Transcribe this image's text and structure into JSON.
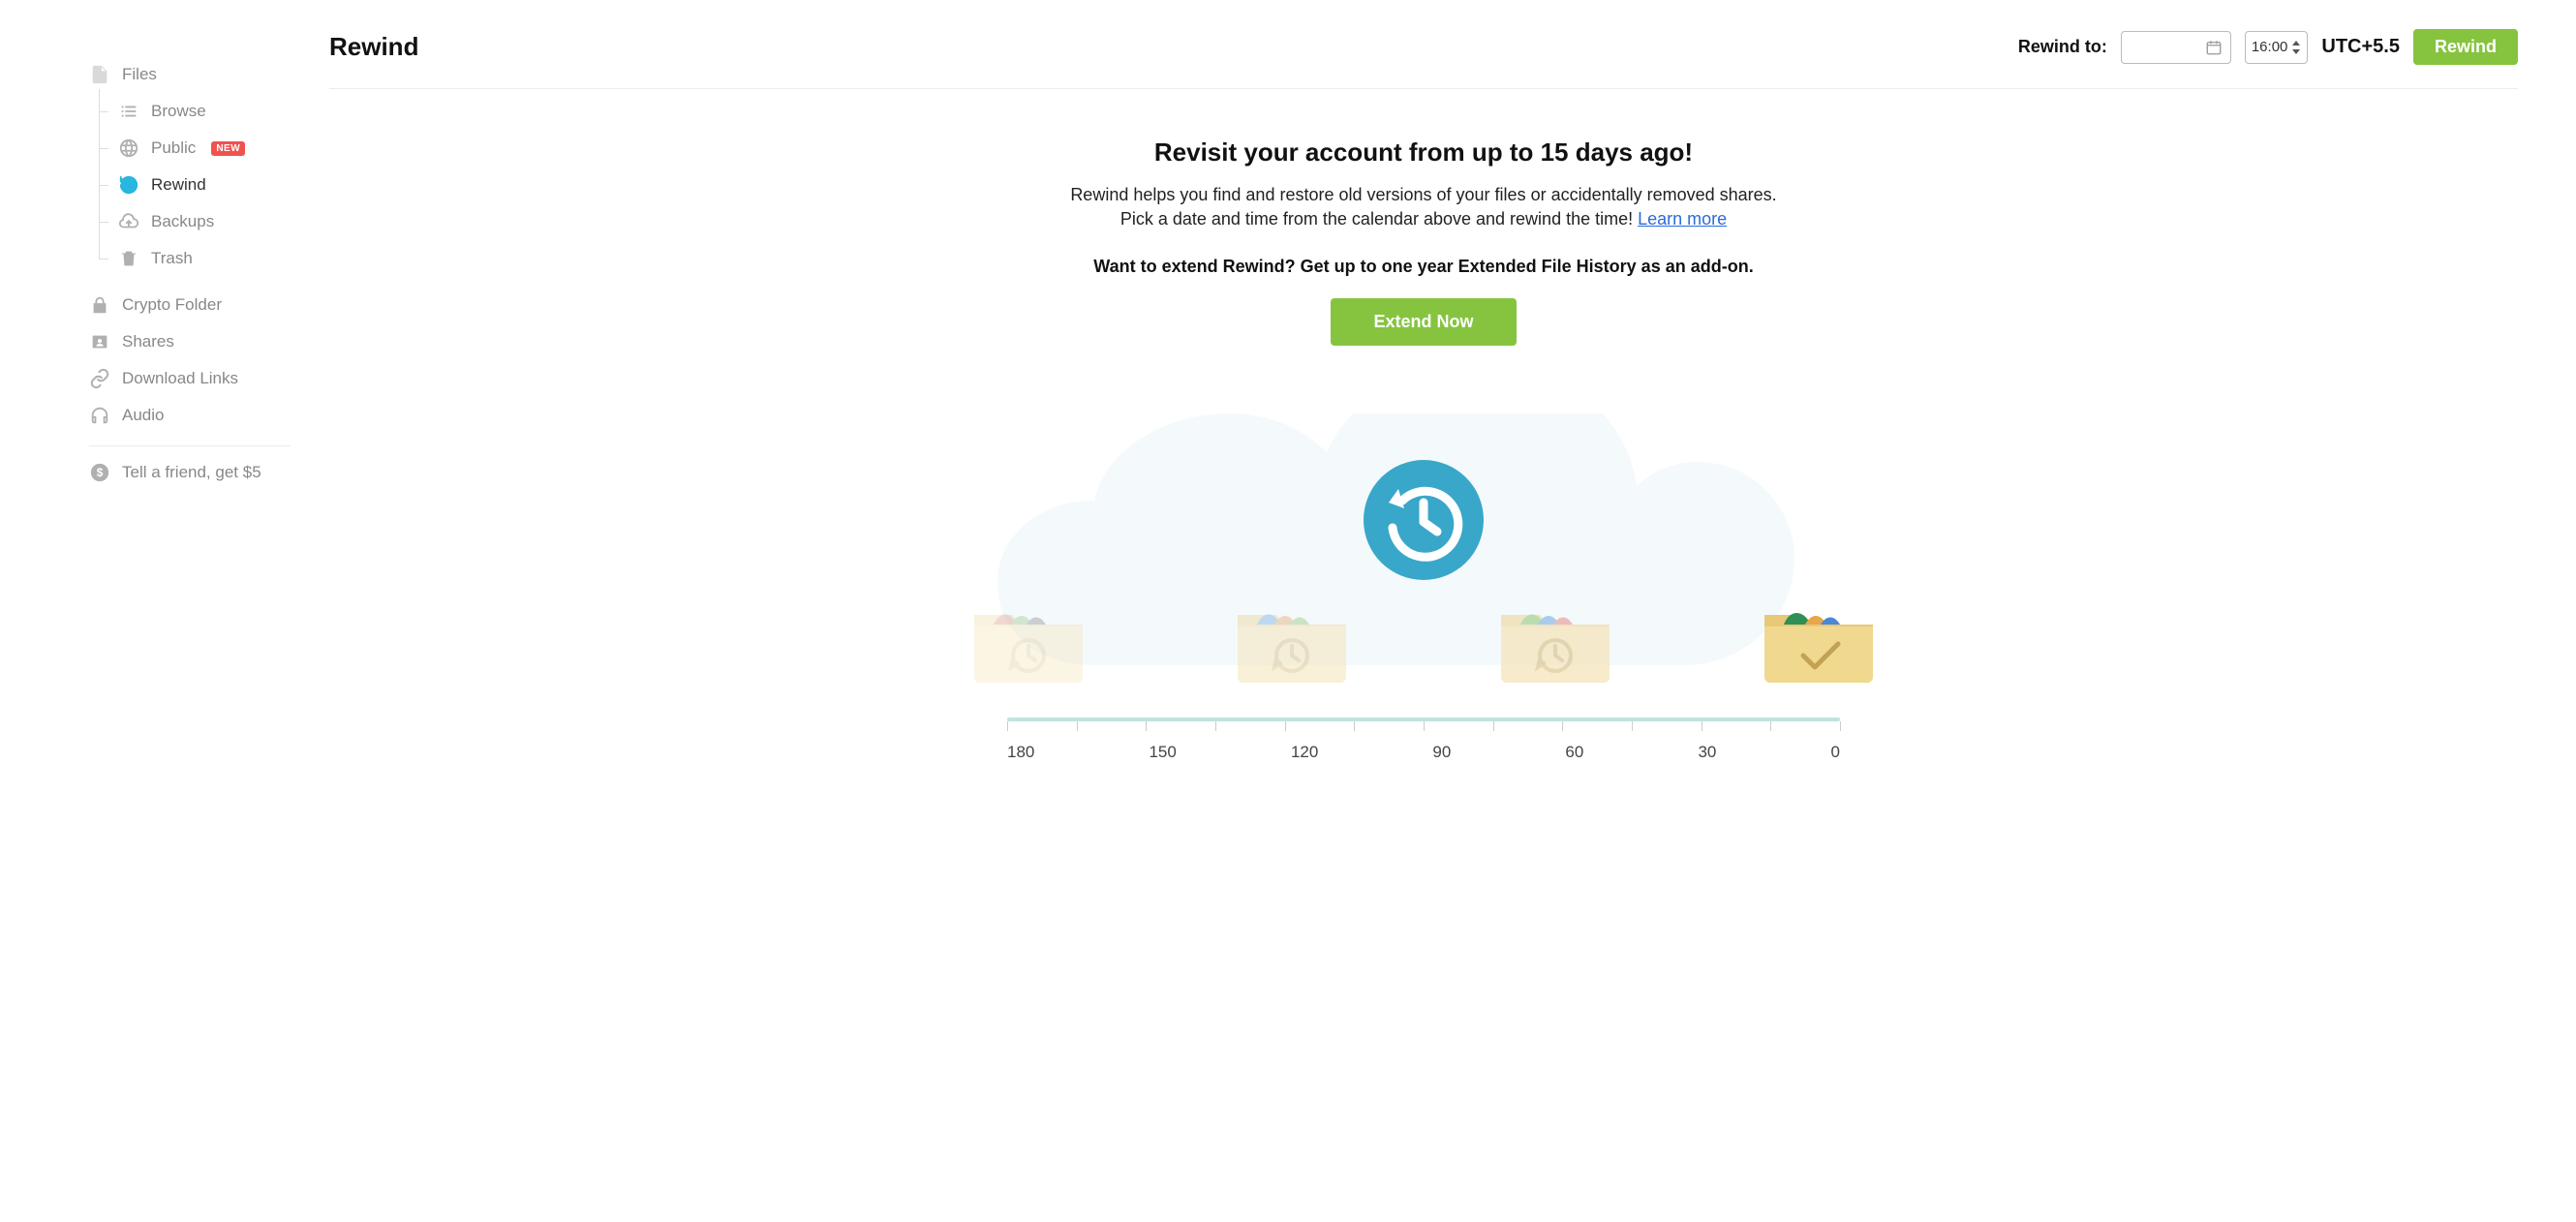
{
  "sidebar": {
    "files_label": "Files",
    "browse_label": "Browse",
    "public_label": "Public",
    "public_badge": "NEW",
    "rewind_label": "Rewind",
    "backups_label": "Backups",
    "trash_label": "Trash",
    "crypto_label": "Crypto Folder",
    "shares_label": "Shares",
    "download_links_label": "Download Links",
    "audio_label": "Audio",
    "tell_friend_label": "Tell a friend, get $5"
  },
  "header": {
    "title": "Rewind",
    "rewind_to_label": "Rewind to:",
    "time_value": "16:00",
    "timezone": "UTC+5.5",
    "rewind_button": "Rewind"
  },
  "content": {
    "headline": "Revisit your account from up to 15 days ago!",
    "desc1": "Rewind helps you find and restore old versions of your files or accidentally removed shares.",
    "desc2_pre": "Pick a date and time from the calendar above and rewind the time! ",
    "learn_more": "Learn more",
    "extend_q": "Want to extend Rewind? Get up to one year Extended File History as an add-on.",
    "extend_button": "Extend Now"
  },
  "timeline": {
    "labels": [
      "180",
      "150",
      "120",
      "90",
      "60",
      "30",
      "0"
    ]
  }
}
